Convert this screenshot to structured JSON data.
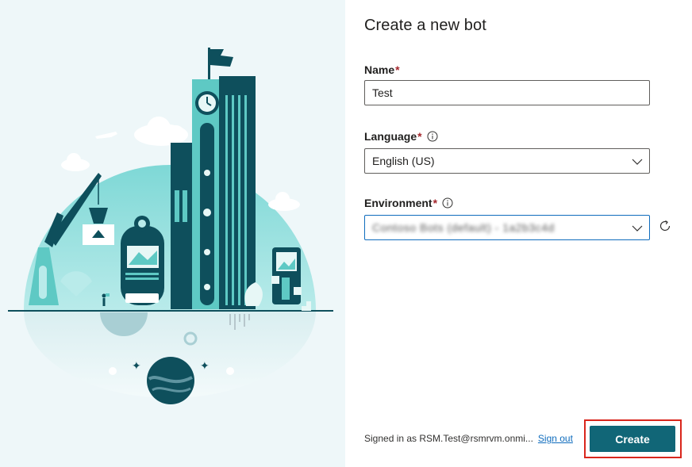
{
  "dialog": {
    "title": "Create a new bot"
  },
  "form": {
    "name": {
      "label": "Name",
      "required_mark": "*",
      "value": "Test"
    },
    "language": {
      "label": "Language",
      "required_mark": "*",
      "value": "English (US)",
      "info_icon": "info-icon"
    },
    "environment": {
      "label": "Environment",
      "required_mark": "*",
      "value": "Contoso Bots (default) - 1a2b3c4d",
      "info_icon": "info-icon"
    }
  },
  "footer": {
    "signed_in_text": "Signed in as RSM.Test@rsmrvm.onmi...",
    "sign_out_label": "Sign out",
    "create_label": "Create"
  },
  "colors": {
    "accent": "#116677",
    "highlight_border": "#d9261c",
    "illustration_teal": "#6fd3cf",
    "illustration_dark": "#0e4f5c"
  },
  "icons": {
    "refresh": "refresh-icon",
    "dropdown": "chevron-down-icon"
  }
}
